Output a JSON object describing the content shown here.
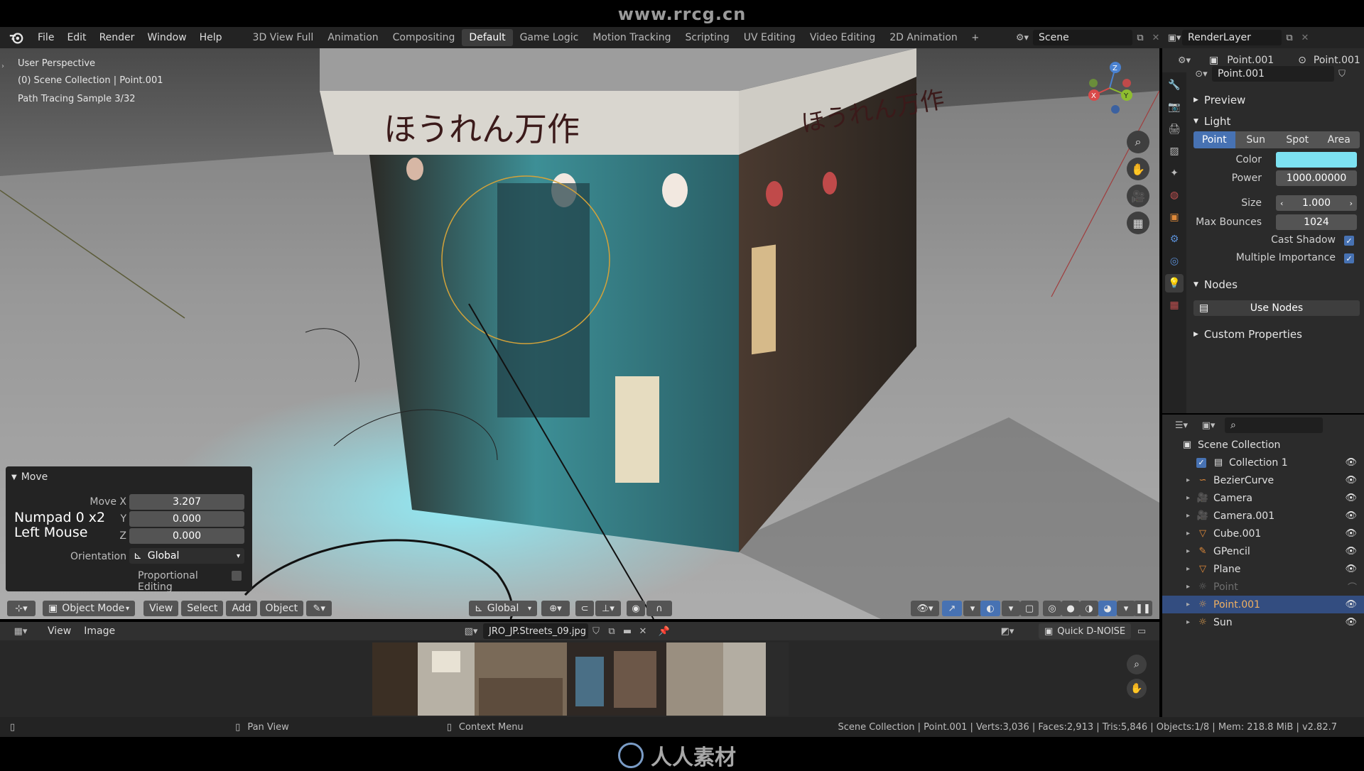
{
  "watermark": {
    "top": "www.rrcg.cn",
    "bottom": "人人素材"
  },
  "menu": [
    "File",
    "Edit",
    "Render",
    "Window",
    "Help"
  ],
  "workspaces": [
    {
      "label": "3D View Full",
      "active": false
    },
    {
      "label": "Animation",
      "active": false
    },
    {
      "label": "Compositing",
      "active": false
    },
    {
      "label": "Default",
      "active": true
    },
    {
      "label": "Game Logic",
      "active": false
    },
    {
      "label": "Motion Tracking",
      "active": false
    },
    {
      "label": "Scripting",
      "active": false
    },
    {
      "label": "UV Editing",
      "active": false
    },
    {
      "label": "Video Editing",
      "active": false
    },
    {
      "label": "2D Animation",
      "active": false
    }
  ],
  "header": {
    "scene": "Scene",
    "view_layer": "RenderLayer"
  },
  "viewport": {
    "info_lines": [
      "User Perspective",
      "(0) Scene Collection | Point.001",
      "Path Tracing Sample 3/32"
    ],
    "sign_text_left": "ほうれん万作",
    "sign_text_right": "ほうれん万作"
  },
  "move_panel": {
    "title": "Move",
    "hint_line1": "Numpad 0 x2",
    "hint_line2": "Left Mouse",
    "move_x_label": "Move X",
    "move_x": "3.207",
    "y_label": "Y",
    "y": "0.000",
    "z_label": "Z",
    "z": "0.000",
    "orientation_label": "Orientation",
    "orientation": "Global",
    "proportional_label": "Proportional Editing"
  },
  "vp_toolbar": {
    "mode": "Object Mode",
    "view": "View",
    "select": "Select",
    "add": "Add",
    "object": "Object",
    "transform": "Global"
  },
  "image_editor": {
    "view": "View",
    "image": "Image",
    "filename": "JRO_JP.Streets_09.jpg",
    "denoise": "Quick D-NOISE"
  },
  "statusbar": {
    "pan": "Pan View",
    "context": "Context Menu",
    "stats": "Scene Collection | Point.001 | Verts:3,036 | Faces:2,913 | Tris:5,846 | Objects:1/8 | Mem: 218.8 MiB | v2.82.7"
  },
  "properties": {
    "object_name": "Point.001",
    "data_name": "Point.001",
    "light_name": "Point.001",
    "sections": {
      "preview": "Preview",
      "light": "Light",
      "nodes": "Nodes",
      "custom": "Custom Properties"
    },
    "light_types": [
      {
        "label": "Point",
        "active": true
      },
      {
        "label": "Sun",
        "active": false
      },
      {
        "label": "Spot",
        "active": false
      },
      {
        "label": "Area",
        "active": false
      }
    ],
    "color_label": "Color",
    "color": "#7de2f2",
    "power_label": "Power",
    "power": "1000.00000",
    "size_label": "Size",
    "size": "1.000",
    "max_bounces_label": "Max Bounces",
    "max_bounces": "1024",
    "cast_shadow_label": "Cast Shadow",
    "multiple_importance_label": "Multiple Importance",
    "use_nodes": "Use Nodes"
  },
  "outliner": {
    "root": "Scene Collection",
    "items": [
      {
        "name": "Collection 1",
        "icon": "collection-icon",
        "level": 1,
        "selected": false,
        "dim": false
      },
      {
        "name": "BezierCurve",
        "icon": "curve-icon",
        "level": 2,
        "selected": false,
        "dim": false
      },
      {
        "name": "Camera",
        "icon": "camera-icon",
        "level": 2,
        "selected": false,
        "dim": false
      },
      {
        "name": "Camera.001",
        "icon": "camera-icon",
        "level": 2,
        "selected": false,
        "dim": false
      },
      {
        "name": "Cube.001",
        "icon": "mesh-icon",
        "level": 2,
        "selected": false,
        "dim": false
      },
      {
        "name": "GPencil",
        "icon": "gpencil-icon",
        "level": 2,
        "selected": false,
        "dim": false
      },
      {
        "name": "Plane",
        "icon": "mesh-icon",
        "level": 2,
        "selected": false,
        "dim": false
      },
      {
        "name": "Point",
        "icon": "light-icon",
        "level": 2,
        "selected": false,
        "dim": true
      },
      {
        "name": "Point.001",
        "icon": "light-icon",
        "level": 2,
        "selected": true,
        "dim": false
      },
      {
        "name": "Sun",
        "icon": "light-icon",
        "level": 2,
        "selected": false,
        "dim": false
      }
    ]
  },
  "colors": {
    "accent": "#4772b3",
    "selection": "#334d80",
    "light_color": "#7de2f2"
  }
}
